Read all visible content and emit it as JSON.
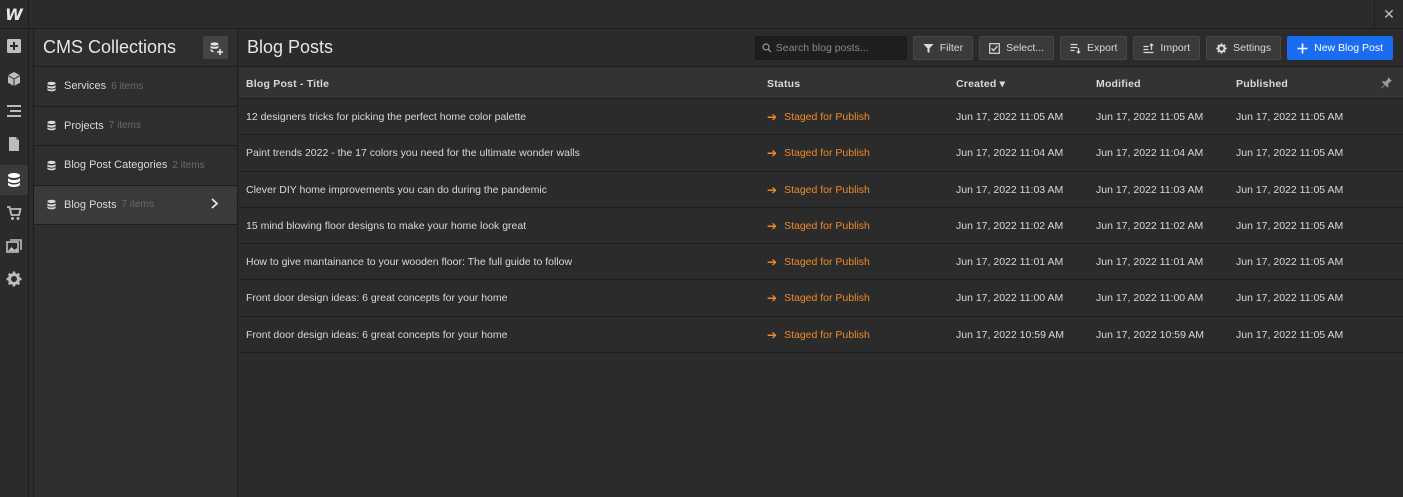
{
  "app": {
    "logo_text": "W",
    "close_glyph": "✕"
  },
  "rail": {
    "items": [
      {
        "icon": "add-icon"
      },
      {
        "icon": "cube-icon"
      },
      {
        "icon": "navigator-icon"
      },
      {
        "icon": "pages-icon"
      },
      {
        "icon": "database-icon",
        "active": true
      },
      {
        "icon": "cart-icon"
      },
      {
        "icon": "assets-icon"
      },
      {
        "icon": "gear-icon"
      }
    ]
  },
  "collections": {
    "title": "CMS Collections",
    "items": [
      {
        "name": "Services",
        "count": "6 items"
      },
      {
        "name": "Projects",
        "count": "7 items"
      },
      {
        "name": "Blog Post Categories",
        "count": "2 items"
      },
      {
        "name": "Blog Posts",
        "count": "7 items",
        "active": true
      }
    ]
  },
  "main": {
    "title": "Blog Posts",
    "search_placeholder": "Search blog posts...",
    "buttons": {
      "filter": "Filter",
      "select": "Select...",
      "export": "Export",
      "import": "Import",
      "settings": "Settings",
      "new": "New Blog Post"
    },
    "columns": {
      "title": "Blog Post - Title",
      "status": "Status",
      "created": "Created ▾",
      "modified": "Modified",
      "published": "Published"
    },
    "rows": [
      {
        "title": "12 designers tricks for picking the perfect home color palette",
        "status": "Staged for Publish",
        "created": "Jun 17, 2022 11:05 AM",
        "modified": "Jun 17, 2022 11:05 AM",
        "published": "Jun 17, 2022 11:05 AM"
      },
      {
        "title": "Paint trends 2022 - the 17 colors you need for the ultimate wonder walls",
        "status": "Staged for Publish",
        "created": "Jun 17, 2022 11:04 AM",
        "modified": "Jun 17, 2022 11:04 AM",
        "published": "Jun 17, 2022 11:05 AM"
      },
      {
        "title": "Clever DIY home improvements you can do during the pandemic",
        "status": "Staged for Publish",
        "created": "Jun 17, 2022 11:03 AM",
        "modified": "Jun 17, 2022 11:03 AM",
        "published": "Jun 17, 2022 11:05 AM"
      },
      {
        "title": "15 mind blowing floor designs to make your home look great",
        "status": "Staged for Publish",
        "created": "Jun 17, 2022 11:02 AM",
        "modified": "Jun 17, 2022 11:02 AM",
        "published": "Jun 17, 2022 11:05 AM"
      },
      {
        "title": "How to give mantainance to your wooden floor: The full guide to follow",
        "status": "Staged for Publish",
        "created": "Jun 17, 2022 11:01 AM",
        "modified": "Jun 17, 2022 11:01 AM",
        "published": "Jun 17, 2022 11:05 AM"
      },
      {
        "title": "Front door design ideas: 6 great concepts for your home",
        "status": "Staged for Publish",
        "created": "Jun 17, 2022 11:00 AM",
        "modified": "Jun 17, 2022 11:00 AM",
        "published": "Jun 17, 2022 11:05 AM"
      },
      {
        "title": "Front door design ideas: 6 great concepts for your home",
        "status": "Staged for Publish",
        "created": "Jun 17, 2022 10:59 AM",
        "modified": "Jun 17, 2022 10:59 AM",
        "published": "Jun 17, 2022 11:05 AM"
      }
    ]
  },
  "colors": {
    "accent": "#1a6df0",
    "status": "#f08a2a",
    "background": "#2b2b2b"
  }
}
